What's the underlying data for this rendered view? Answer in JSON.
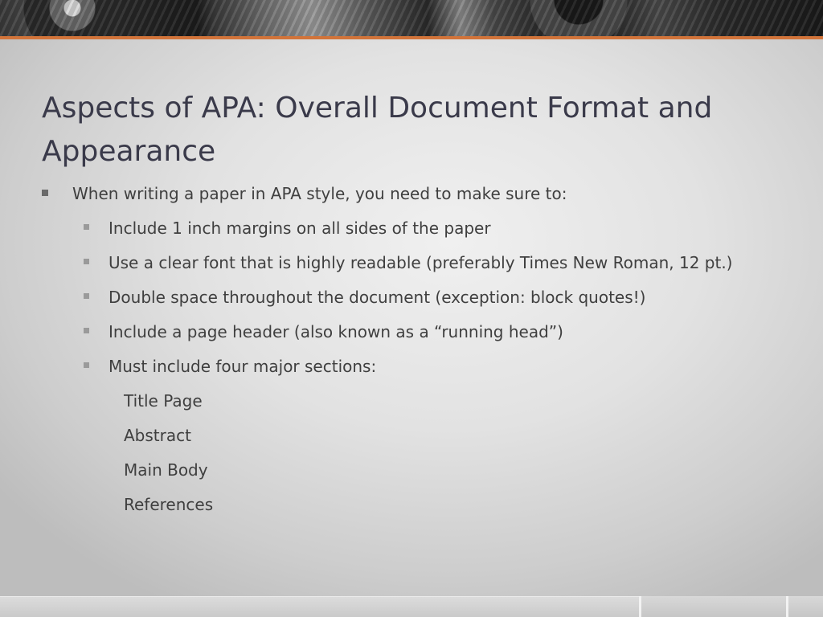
{
  "slide": {
    "title": "Aspects of APA: Overall Document Format and Appearance",
    "intro": "When writing a paper in APA style, you need to make sure to:",
    "requirements": [
      "Include 1 inch margins on all sides of the paper",
      "Use a clear font that is highly readable (preferably Times New Roman, 12 pt.)",
      "Double space throughout the document (exception: block quotes!)",
      "Include a page header (also known as a “running head”)",
      "Must include four major sections:"
    ],
    "sections": [
      "Title Page",
      "Abstract",
      "Main Body",
      "References"
    ]
  },
  "colors": {
    "accent": "#d2743a",
    "title_text": "#3a3a4a",
    "body_text": "#3f3f3f"
  }
}
